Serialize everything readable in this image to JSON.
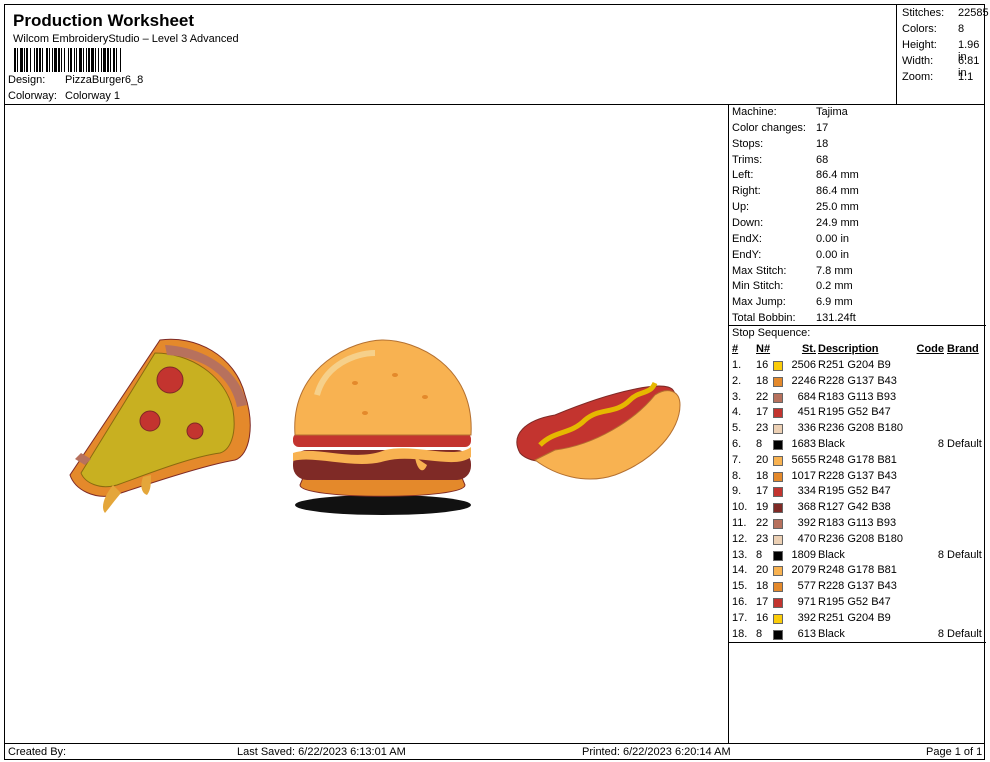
{
  "header": {
    "title": "Production Worksheet",
    "subtitle": "Wilcom EmbroideryStudio – Level 3 Advanced",
    "design_label": "Design:",
    "design_value": "PizzaBurger6_8",
    "colorway_label": "Colorway:",
    "colorway_value": "Colorway 1"
  },
  "stats": [
    {
      "label": "Stitches:",
      "value": "22585"
    },
    {
      "label": "Colors:",
      "value": "8"
    },
    {
      "label": "Height:",
      "value": "1.96 in"
    },
    {
      "label": "Width:",
      "value": "6.81 in"
    },
    {
      "label": "Zoom:",
      "value": "1:1"
    }
  ],
  "machine_info": [
    {
      "label": "Machine:",
      "value": "Tajima"
    },
    {
      "label": "Color changes:",
      "value": "17"
    },
    {
      "label": "Stops:",
      "value": "18"
    },
    {
      "label": "Trims:",
      "value": "68"
    },
    {
      "label": "Left:",
      "value": "86.4 mm"
    },
    {
      "label": "Right:",
      "value": "86.4 mm"
    },
    {
      "label": "Up:",
      "value": "25.0 mm"
    },
    {
      "label": "Down:",
      "value": "24.9 mm"
    },
    {
      "label": "EndX:",
      "value": "0.00 in"
    },
    {
      "label": "EndY:",
      "value": "0.00 in"
    },
    {
      "label": "Max Stitch:",
      "value": "7.8 mm"
    },
    {
      "label": "Min Stitch:",
      "value": "0.2 mm"
    },
    {
      "label": "Max Jump:",
      "value": "6.9 mm"
    },
    {
      "label": "Total Bobbin:",
      "value": "131.24ft"
    }
  ],
  "stop_sequence": {
    "title": "Stop Sequence:",
    "columns": {
      "idx": "#",
      "n": "N#",
      "st": "St.",
      "desc": "Description",
      "code": "Code",
      "brand": "Brand"
    },
    "rows": [
      {
        "idx": "1.",
        "n": "16",
        "color": "#FBCC09",
        "st": "2506",
        "desc": "R251 G204 B9",
        "code": "",
        "brand": ""
      },
      {
        "idx": "2.",
        "n": "18",
        "color": "#E4892B",
        "st": "2246",
        "desc": "R228 G137 B43",
        "code": "",
        "brand": ""
      },
      {
        "idx": "3.",
        "n": "22",
        "color": "#B7715D",
        "st": "684",
        "desc": "R183 G113 B93",
        "code": "",
        "brand": ""
      },
      {
        "idx": "4.",
        "n": "17",
        "color": "#C3342F",
        "st": "451",
        "desc": "R195 G52 B47",
        "code": "",
        "brand": ""
      },
      {
        "idx": "5.",
        "n": "23",
        "color": "#ECD0B4",
        "st": "336",
        "desc": "R236 G208 B180",
        "code": "",
        "brand": ""
      },
      {
        "idx": "6.",
        "n": "8",
        "color": "#000000",
        "st": "1683",
        "desc": "Black",
        "code": "8",
        "brand": "Default"
      },
      {
        "idx": "7.",
        "n": "20",
        "color": "#F8B251",
        "st": "5655",
        "desc": "R248 G178 B81",
        "code": "",
        "brand": ""
      },
      {
        "idx": "8.",
        "n": "18",
        "color": "#E4892B",
        "st": "1017",
        "desc": "R228 G137 B43",
        "code": "",
        "brand": ""
      },
      {
        "idx": "9.",
        "n": "17",
        "color": "#C3342F",
        "st": "334",
        "desc": "R195 G52 B47",
        "code": "",
        "brand": ""
      },
      {
        "idx": "10.",
        "n": "19",
        "color": "#7F2A26",
        "st": "368",
        "desc": "R127 G42 B38",
        "code": "",
        "brand": ""
      },
      {
        "idx": "11.",
        "n": "22",
        "color": "#B7715D",
        "st": "392",
        "desc": "R183 G113 B93",
        "code": "",
        "brand": ""
      },
      {
        "idx": "12.",
        "n": "23",
        "color": "#ECD0B4",
        "st": "470",
        "desc": "R236 G208 B180",
        "code": "",
        "brand": ""
      },
      {
        "idx": "13.",
        "n": "8",
        "color": "#000000",
        "st": "1809",
        "desc": "Black",
        "code": "8",
        "brand": "Default"
      },
      {
        "idx": "14.",
        "n": "20",
        "color": "#F8B251",
        "st": "2079",
        "desc": "R248 G178 B81",
        "code": "",
        "brand": ""
      },
      {
        "idx": "15.",
        "n": "18",
        "color": "#E4892B",
        "st": "577",
        "desc": "R228 G137 B43",
        "code": "",
        "brand": ""
      },
      {
        "idx": "16.",
        "n": "17",
        "color": "#C3342F",
        "st": "971",
        "desc": "R195 G52 B47",
        "code": "",
        "brand": ""
      },
      {
        "idx": "17.",
        "n": "16",
        "color": "#FBCC09",
        "st": "392",
        "desc": "R251 G204 B9",
        "code": "",
        "brand": ""
      },
      {
        "idx": "18.",
        "n": "8",
        "color": "#000000",
        "st": "613",
        "desc": "Black",
        "code": "8",
        "brand": "Default"
      }
    ]
  },
  "footer": {
    "created_by": "Created By:",
    "last_saved": "Last Saved: 6/22/2023 6:13:01 AM",
    "printed": "Printed: 6/22/2023 6:20:14 AM",
    "page": "Page 1 of 1"
  }
}
